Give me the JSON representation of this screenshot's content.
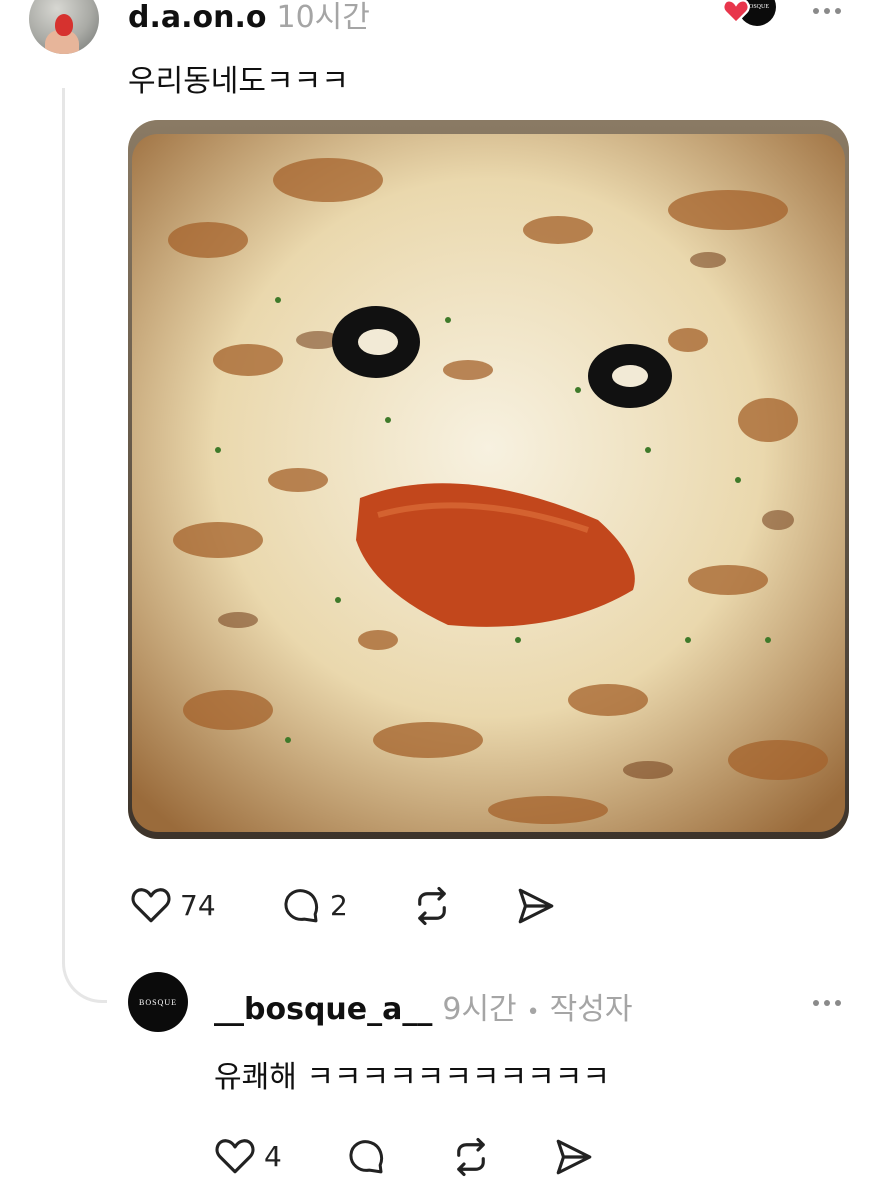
{
  "comment": {
    "username": "d.a.on.o",
    "time": "10시간",
    "text": "우리동네도ㅋㅋㅋ",
    "likes": "74",
    "replies": "2"
  },
  "reply": {
    "avatar_text": "BOSQUE",
    "username": "__bosque_a__",
    "time": "9시간",
    "separator": "•",
    "author_badge": "작성자",
    "text": "유쾌해 ㅋㅋㅋㅋㅋㅋㅋㅋㅋㅋㅋ",
    "likes": "4"
  },
  "liked_badge": {
    "avatar_text": "BOSQUE",
    "icon": "heart-icon",
    "color": "#e8364c"
  },
  "icons": [
    "heart-icon",
    "comment-icon",
    "repost-icon",
    "share-icon",
    "more-icon"
  ],
  "colors": {
    "text": "#101010",
    "muted": "#a5a5a5",
    "thread_line": "#e6e6e6"
  }
}
